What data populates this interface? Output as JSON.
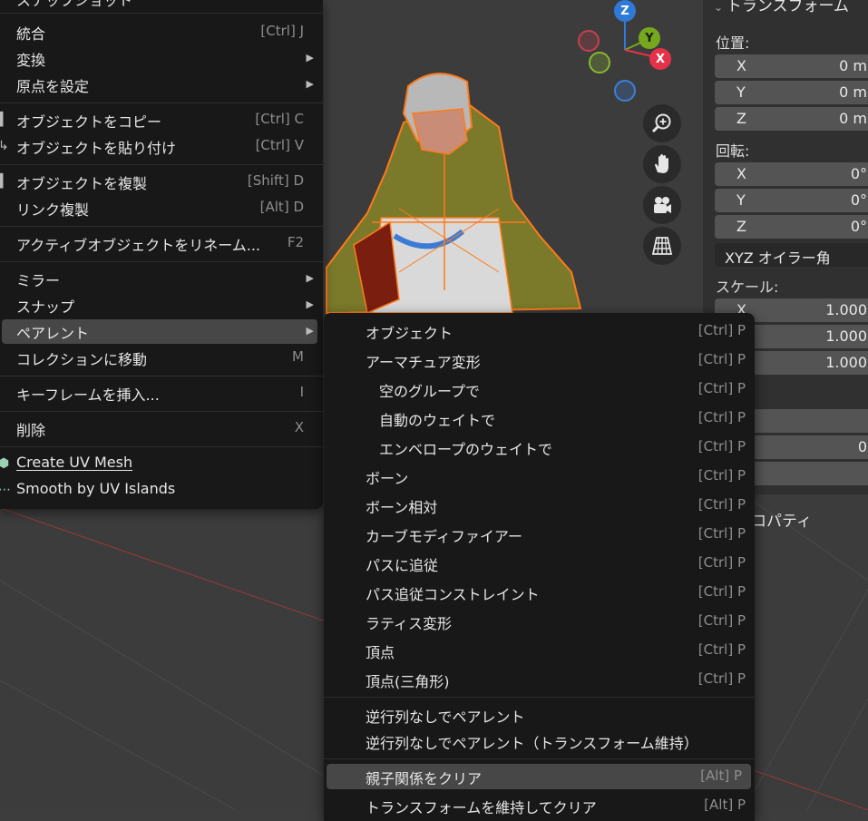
{
  "viewport": {
    "gizmo": {
      "z": "Z",
      "y": "Y",
      "x": "X"
    }
  },
  "properties": {
    "header": "トランスフォーム",
    "location_label": "位置:",
    "location": [
      {
        "axis": "X",
        "value": "0 m"
      },
      {
        "axis": "Y",
        "value": "0 m"
      },
      {
        "axis": "Z",
        "value": "0 m"
      }
    ],
    "rotation_label": "回転:",
    "rotation": [
      {
        "axis": "X",
        "value": "0°"
      },
      {
        "axis": "Y",
        "value": "0°"
      },
      {
        "axis": "Z",
        "value": "0°"
      }
    ],
    "rotation_mode": "XYZ オイラー角",
    "scale_label": "スケール:",
    "scale": [
      {
        "axis": "X",
        "value": "1.000"
      },
      {
        "axis": "",
        "value": "1.000"
      },
      {
        "axis": "",
        "value": "1.000"
      }
    ],
    "extra_value": "0",
    "bottom_text": "ロパティ"
  },
  "menu": {
    "top_partial": "スナップショット",
    "items": [
      {
        "label": "統合",
        "shortcut": "[Ctrl] J"
      },
      {
        "label": "変換",
        "submenu": true
      },
      {
        "label": "原点を設定",
        "submenu": true
      },
      {
        "label": "オブジェクトをコピー",
        "shortcut": "[Ctrl] C"
      },
      {
        "label": "オブジェクトを貼り付け",
        "shortcut": "[Ctrl] V"
      },
      {
        "label": "オブジェクトを複製",
        "shortcut": "[Shift] D"
      },
      {
        "label": "リンク複製",
        "shortcut": "[Alt] D"
      },
      {
        "label": "アクティブオブジェクトをリネーム...",
        "shortcut": "F2"
      },
      {
        "label": "ミラー",
        "submenu": true
      },
      {
        "label": "スナップ",
        "submenu": true
      },
      {
        "label": "ペアレント",
        "submenu": true
      },
      {
        "label": "コレクションに移動",
        "shortcut": "M"
      },
      {
        "label": "キーフレームを挿入...",
        "shortcut": "I"
      },
      {
        "label": "削除",
        "shortcut": "X"
      },
      {
        "label": "Create UV Mesh"
      },
      {
        "label": "Smooth by UV Islands"
      }
    ],
    "arrow": "▶"
  },
  "submenu": {
    "items": [
      {
        "label": "オブジェクト",
        "shortcut": "[Ctrl] P"
      },
      {
        "label": "アーマチュア変形",
        "shortcut": "[Ctrl] P"
      },
      {
        "label": "空のグループで",
        "shortcut": "[Ctrl] P"
      },
      {
        "label": "自動のウェイトで",
        "shortcut": "[Ctrl] P"
      },
      {
        "label": "エンベロープのウェイトで",
        "shortcut": "[Ctrl] P"
      },
      {
        "label": "ボーン",
        "shortcut": "[Ctrl] P"
      },
      {
        "label": "ボーン相対",
        "shortcut": "[Ctrl] P"
      },
      {
        "label": "カーブモディファイアー",
        "shortcut": "[Ctrl] P"
      },
      {
        "label": "パスに追従",
        "shortcut": "[Ctrl] P"
      },
      {
        "label": "パス追従コンストレイント",
        "shortcut": "[Ctrl] P"
      },
      {
        "label": "ラティス変形",
        "shortcut": "[Ctrl] P"
      },
      {
        "label": "頂点",
        "shortcut": "[Ctrl] P"
      },
      {
        "label": "頂点(三角形)",
        "shortcut": "[Ctrl] P"
      },
      {
        "label": "逆行列なしでペアレント"
      },
      {
        "label": "逆行列なしでペアレント（トランスフォーム維持）"
      },
      {
        "label": "親子関係をクリア",
        "shortcut": "[Alt] P"
      },
      {
        "label": "トランスフォームを維持してクリア",
        "shortcut": "[Alt] P"
      }
    ]
  }
}
